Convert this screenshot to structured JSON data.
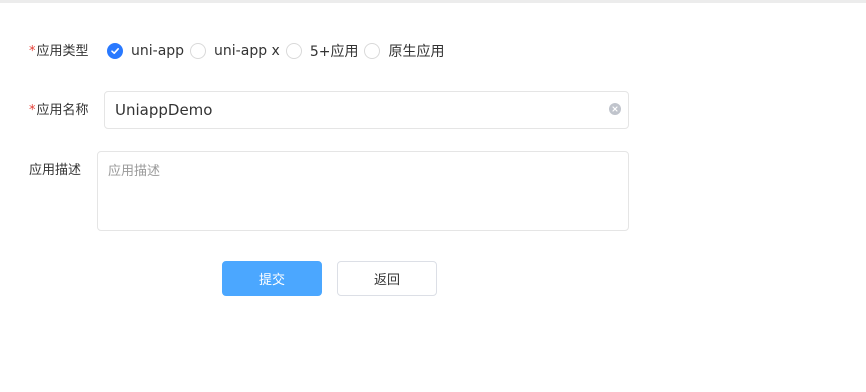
{
  "form": {
    "app_type": {
      "required_mark": "*",
      "label": "应用类型",
      "options": [
        {
          "label": "uni-app",
          "checked": true
        },
        {
          "label": "uni-app x",
          "checked": false
        },
        {
          "label": "5+应用",
          "checked": false
        },
        {
          "label": "原生应用",
          "checked": false
        }
      ]
    },
    "app_name": {
      "required_mark": "*",
      "label": "应用名称",
      "value": "UniappDemo"
    },
    "app_desc": {
      "label": "应用描述",
      "placeholder": "应用描述"
    }
  },
  "buttons": {
    "submit_label": "提交",
    "back_label": "返回"
  },
  "colors": {
    "primary": "#2979ff",
    "submit_bg": "#4ba7ff",
    "required": "#e43d33",
    "border": "#e5e5e5"
  }
}
